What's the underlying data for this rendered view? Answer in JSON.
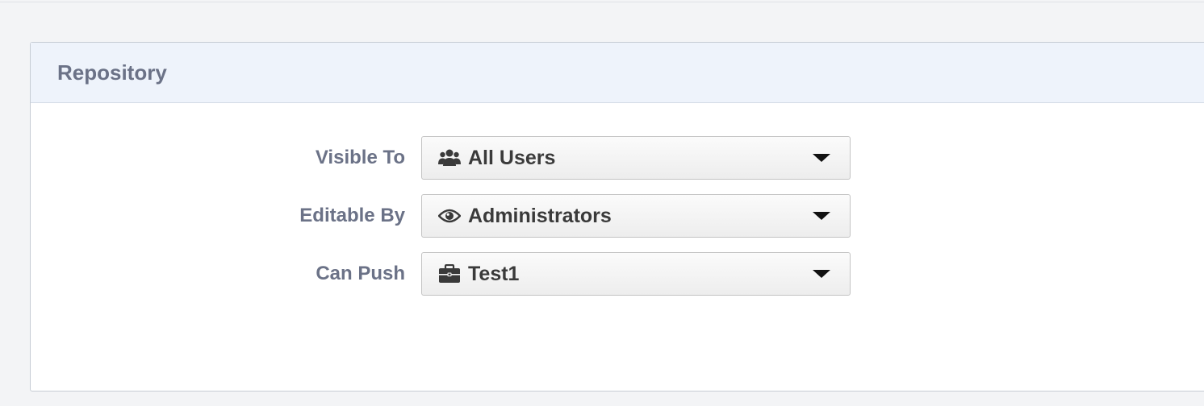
{
  "panel": {
    "title": "Repository"
  },
  "form": {
    "visible_to": {
      "label": "Visible To",
      "value": "All Users",
      "icon": "users-icon"
    },
    "editable_by": {
      "label": "Editable By",
      "value": "Administrators",
      "icon": "eye-icon"
    },
    "can_push": {
      "label": "Can Push",
      "value": "Test1",
      "icon": "briefcase-icon"
    }
  },
  "colors": {
    "page_background": "#f3f4f6",
    "header_background": "#eef3fb",
    "label_text": "#6b7287",
    "value_text": "#3a3a3a"
  }
}
